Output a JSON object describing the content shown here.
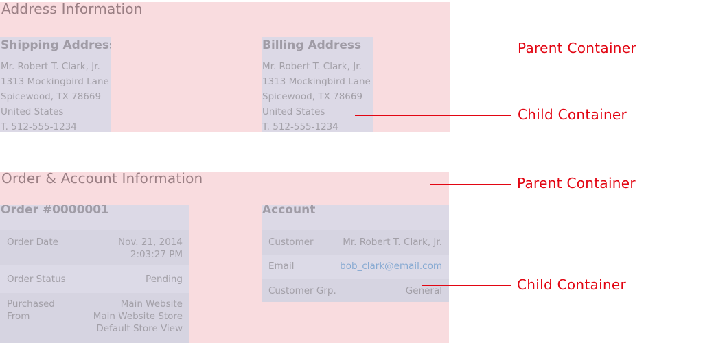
{
  "address_section": {
    "title": "Address Information",
    "shipping": {
      "title": "Shipping Address",
      "lines": [
        "Mr. Robert T. Clark, Jr.",
        "1313 Mockingbird Lane",
        "Spicewood, TX 78669",
        "United States",
        "T. 512-555-1234"
      ]
    },
    "billing": {
      "title": "Billing Address",
      "lines": [
        "Mr. Robert T. Clark, Jr.",
        "1313 Mockingbird Lane",
        "Spicewood, TX 78669",
        "United States",
        "T. 512-555-1234"
      ]
    }
  },
  "order_section": {
    "title": "Order & Account Information",
    "order": {
      "title": "Order #0000001",
      "rows": [
        {
          "label": "Order Date",
          "value": "Nov. 21, 2014\n2:03:27 PM"
        },
        {
          "label": "Order Status",
          "value": "Pending"
        },
        {
          "label": "Purchased\nFrom",
          "value": "Main Website\nMain Website Store\nDefault Store View"
        }
      ]
    },
    "account": {
      "title": "Account",
      "rows": [
        {
          "label": "Customer",
          "value": "Mr. Robert T. Clark, Jr."
        },
        {
          "label": "Email",
          "value": "bob_clark@email.com"
        },
        {
          "label": "Customer Grp.",
          "value": "General"
        }
      ]
    }
  },
  "callouts": {
    "parent_1": "Parent Container",
    "child_1": "Child Container",
    "parent_2": "Parent Container",
    "child_2": "Child Container"
  },
  "colors": {
    "parent_bg": "#f9dcdf",
    "child_bg": "#dcd9e6",
    "callout": "#e20613",
    "link": "#86a9d2"
  }
}
